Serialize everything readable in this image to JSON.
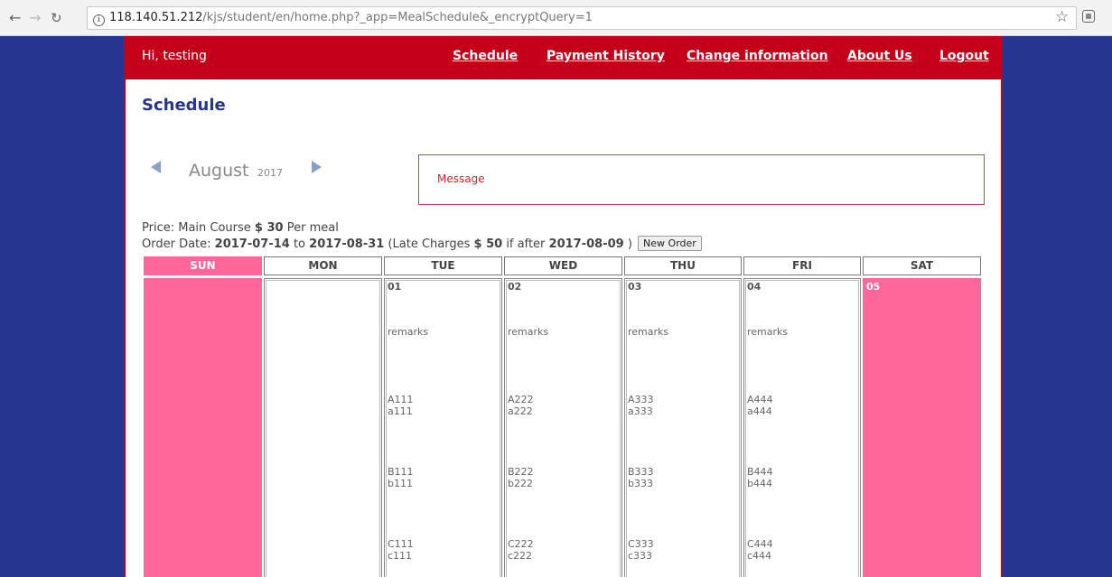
{
  "browser": {
    "url_host": "118.140.51.212",
    "url_path": "/kjs/student/en/home.php?_app=MealSchedule&_encryptQuery=1"
  },
  "topbar": {
    "greeting": "Hi, testing",
    "nav": [
      "Schedule",
      "Payment History",
      "Change information",
      "About Us",
      "Logout"
    ]
  },
  "page_title": "Schedule",
  "calendar_nav": {
    "month": "August",
    "year": "2017"
  },
  "message": "Message",
  "price": {
    "label": "Price: Main Course ",
    "amount": "$ 30",
    "suffix": " Per meal"
  },
  "order": {
    "label": "Order Date: ",
    "start": "2017-07-14",
    "to": " to ",
    "end": "2017-08-31",
    "late_prefix": " (Late Charges ",
    "late_amount": "$ 50",
    "late_mid": " if after ",
    "late_date": "2017-08-09",
    "late_suffix": " )",
    "button": "New Order"
  },
  "days": [
    "SUN",
    "MON",
    "TUE",
    "WED",
    "THU",
    "FRI",
    "SAT"
  ],
  "cells": [
    {
      "date": "",
      "remarks": "",
      "a": [
        "",
        ""
      ],
      "b": [
        "",
        ""
      ],
      "c": [
        "",
        ""
      ]
    },
    {
      "date": "",
      "remarks": "",
      "a": [
        "",
        ""
      ],
      "b": [
        "",
        ""
      ],
      "c": [
        "",
        ""
      ]
    },
    {
      "date": "01",
      "remarks": "remarks",
      "a": [
        "A111",
        "a111"
      ],
      "b": [
        "B111",
        "b111"
      ],
      "c": [
        "C111",
        "c111"
      ]
    },
    {
      "date": "02",
      "remarks": "remarks",
      "a": [
        "A222",
        "a222"
      ],
      "b": [
        "B222",
        "b222"
      ],
      "c": [
        "C222",
        "c222"
      ]
    },
    {
      "date": "03",
      "remarks": "remarks",
      "a": [
        "A333",
        "a333"
      ],
      "b": [
        "B333",
        "b333"
      ],
      "c": [
        "C333",
        "c333"
      ]
    },
    {
      "date": "04",
      "remarks": "remarks",
      "a": [
        "A444",
        "a444"
      ],
      "b": [
        "B444",
        "b444"
      ],
      "c": [
        "C444",
        "c444"
      ]
    },
    {
      "date": "05",
      "remarks": "",
      "a": [
        "",
        ""
      ],
      "b": [
        "",
        ""
      ],
      "c": [
        "",
        ""
      ]
    }
  ],
  "colors": {
    "brand_red": "#c4001a",
    "brand_blue": "#26368e",
    "weekend_pink": "#ff6699"
  }
}
